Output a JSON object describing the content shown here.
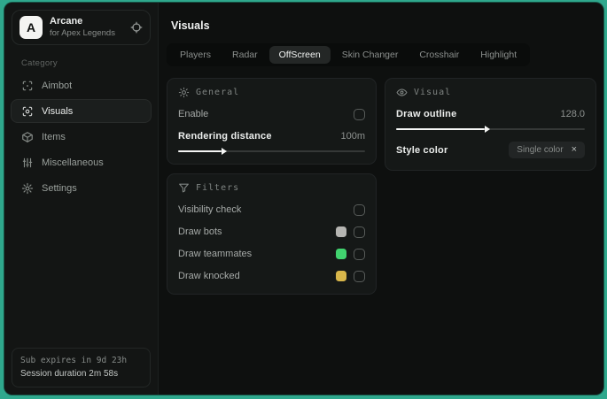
{
  "sidebar": {
    "brand": {
      "logo_letter": "A",
      "name": "Arcane",
      "subtitle": "for Apex Legends"
    },
    "category_label": "Category",
    "items": [
      {
        "label": "Aimbot"
      },
      {
        "label": "Visuals"
      },
      {
        "label": "Items"
      },
      {
        "label": "Miscellaneous"
      },
      {
        "label": "Settings"
      }
    ],
    "footer": {
      "sub_expires": "Sub expires in 9d 23h",
      "session_duration": "Session duration 2m 58s"
    }
  },
  "main": {
    "title": "Visuals",
    "tabs": [
      {
        "label": "Players"
      },
      {
        "label": "Radar"
      },
      {
        "label": "OffScreen"
      },
      {
        "label": "Skin Changer"
      },
      {
        "label": "Crosshair"
      },
      {
        "label": "Highlight"
      }
    ],
    "active_tab": "OffScreen"
  },
  "panels": {
    "general": {
      "title": "General",
      "enable_label": "Enable",
      "enable_checked": false,
      "rendering_distance_label": "Rendering distance",
      "rendering_distance_value": "100m",
      "rendering_distance_pct": 23
    },
    "visual": {
      "title": "Visual",
      "draw_outline_label": "Draw outline",
      "draw_outline_value": "128.0",
      "draw_outline_pct": 47,
      "style_color_label": "Style color",
      "style_color_value": "Single color",
      "clear_glyph": "×"
    },
    "filters": {
      "title": "Filters",
      "rows": [
        {
          "label": "Visibility check",
          "swatch": null,
          "checked": false
        },
        {
          "label": "Draw bots",
          "swatch": "#b5b5b2",
          "checked": false
        },
        {
          "label": "Draw teammates",
          "swatch": "#41d36f",
          "checked": false
        },
        {
          "label": "Draw knocked",
          "swatch": "#d8b64a",
          "checked": false
        }
      ]
    }
  },
  "colors": {
    "desktop_background": "#2fa88d",
    "swatch_bots": "#b5b5b2",
    "swatch_teammates": "#41d36f",
    "swatch_knocked": "#d8b64a"
  }
}
